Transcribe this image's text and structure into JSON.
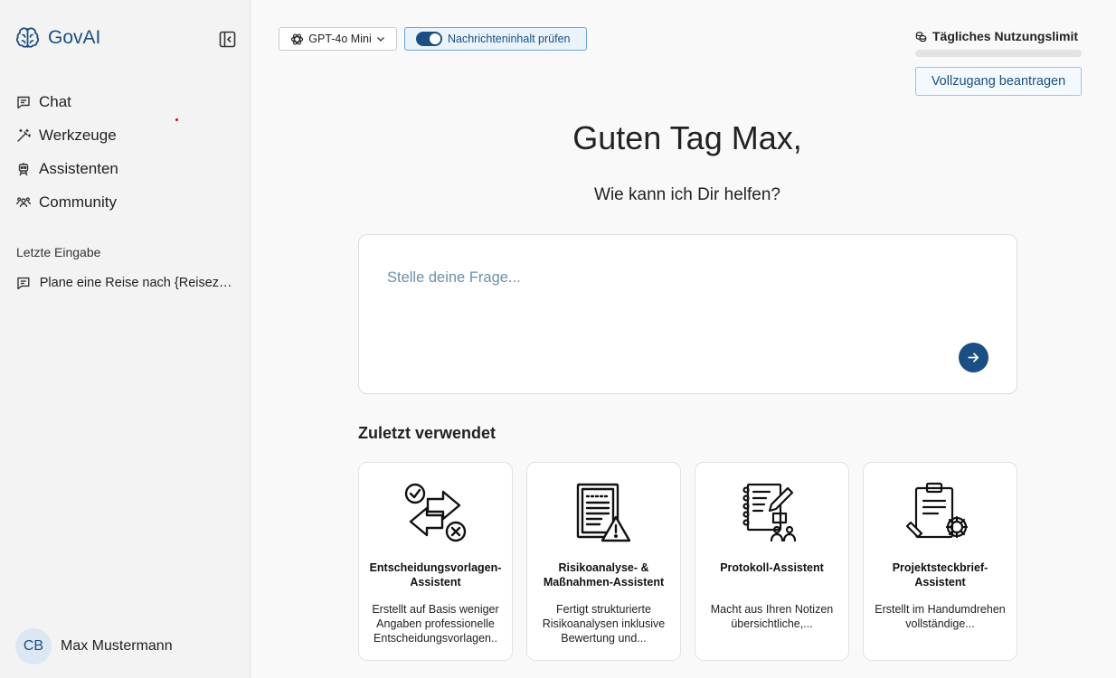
{
  "brand": {
    "name": "GovAI"
  },
  "nav": [
    {
      "label": "Chat",
      "icon": "chat-icon"
    },
    {
      "label": "Werkzeuge",
      "icon": "magic-wand-icon"
    },
    {
      "label": "Assistenten",
      "icon": "robot-icon"
    },
    {
      "label": "Community",
      "icon": "users-icon"
    }
  ],
  "recent": {
    "label": "Letzte Eingabe",
    "items": [
      {
        "label": "Plane eine Reise nach {Reiseziel}"
      }
    ]
  },
  "user": {
    "initials": "CB",
    "name": "Max Mustermann"
  },
  "toolbar": {
    "model_label": "GPT-4o Mini",
    "check_label": "Nachrichteninhalt prüfen",
    "check_enabled": true
  },
  "limit": {
    "title": "Tägliches Nutzungslimit",
    "used_fraction": 0.0
  },
  "access_button": "Vollzugang beantragen",
  "main": {
    "greeting": "Guten Tag Max,",
    "subgreeting": "Wie kann ich Dir helfen?",
    "prompt_placeholder": "Stelle deine Frage...",
    "prompt_value": "",
    "recent_title": "Zuletzt verwendet"
  },
  "cards": [
    {
      "title": "Entscheidungsvorlagen-Assistent",
      "desc": "Erstellt auf Basis weniger Angaben professionelle Entscheidungsvorlagen..",
      "icon": "decision-icon"
    },
    {
      "title": "Risikoanalyse- & Maßnahmen-Assistent",
      "desc": "Fertigt strukturierte Risikoanalysen inklusive Bewertung und...",
      "icon": "risk-document-icon"
    },
    {
      "title": "Protokoll-Assistent",
      "desc": "Macht aus Ihren Notizen übersichtliche,...",
      "icon": "protocol-notebook-icon"
    },
    {
      "title": "Projektsteckbrief-Assistent",
      "desc": "Erstellt im Handumdrehen vollständige...",
      "icon": "clipboard-gear-icon"
    }
  ],
  "colors": {
    "accent": "#1a4f83",
    "sidebar_bg": "#f3f3f3",
    "page_bg": "#f9f9f9"
  }
}
